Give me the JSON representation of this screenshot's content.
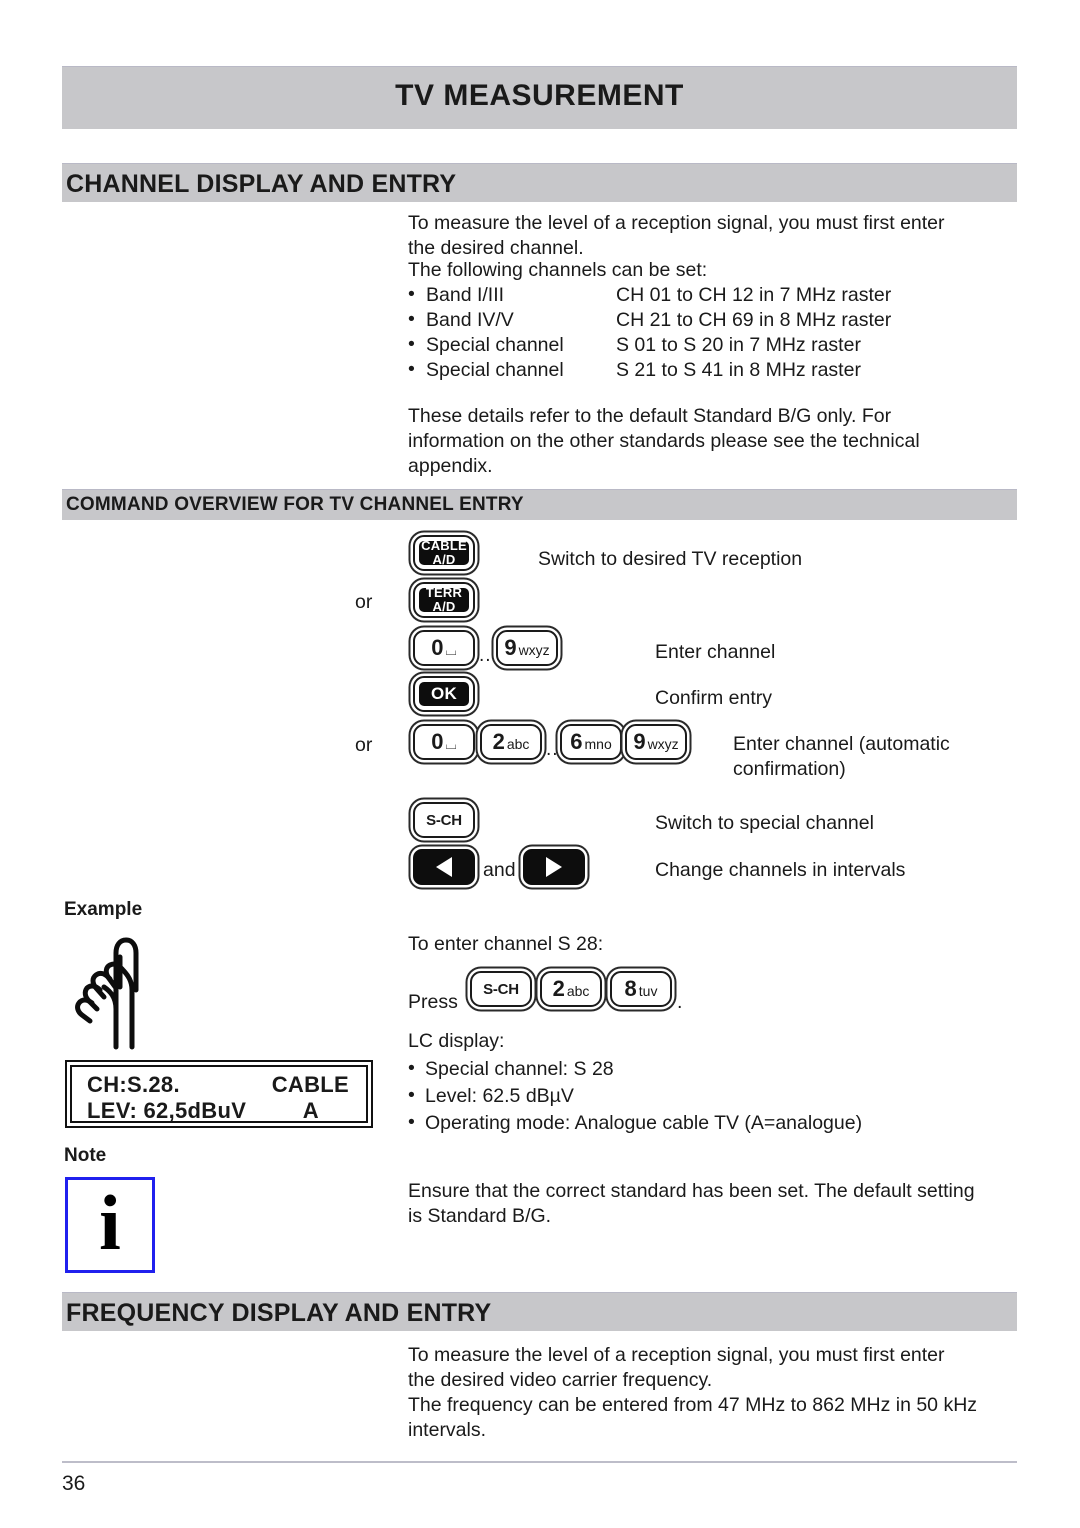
{
  "page": {
    "title": "TV MEASUREMENT",
    "number": "36"
  },
  "sections": {
    "channel": {
      "heading": "CHANNEL DISPLAY AND ENTRY",
      "intro_line1": "To measure the level of a reception signal, you must first enter",
      "intro_line2": "the desired channel.",
      "intro_line3": "The following channels can be set:",
      "channel_table": [
        {
          "bullet": "•",
          "band": "Band I/III",
          "range": "CH 01 to CH 12 in 7 MHz raster"
        },
        {
          "bullet": "•",
          "band": "Band IV/V",
          "range": "CH 21 to CH 69 in 8 MHz raster"
        },
        {
          "bullet": "•",
          "band": "Special channel",
          "range": "S 01 to S 20 in 7 MHz raster"
        },
        {
          "bullet": "•",
          "band": "Special channel",
          "range": "S 21 to S 41 in 8 MHz raster"
        }
      ],
      "note_line1": "These details refer to the default Standard B/G only. For",
      "note_line2": "information on the other standards please see the technical",
      "note_line3": "appendix."
    },
    "command_overview": {
      "heading": "COMMAND OVERVIEW FOR TV CHANNEL ENTRY",
      "or_label_1": "or",
      "or_label_2": "or",
      "and_label": "and",
      "ellipsis_1": "...",
      "ellipsis_2": "...",
      "keys": {
        "cable": {
          "line1": "CABLE",
          "line2": "A/D"
        },
        "terr": {
          "line1": "TERR",
          "line2": "A/D"
        },
        "zero": {
          "num": "0",
          "sub": "⌴"
        },
        "nine": {
          "num": "9",
          "sub": "wxyz"
        },
        "ok": {
          "label": "OK"
        },
        "two": {
          "num": "2",
          "sub": "abc"
        },
        "six": {
          "num": "6",
          "sub": "mno"
        },
        "nine2": {
          "num": "9",
          "sub": "wxyz"
        },
        "sch": {
          "label": "S-CH"
        },
        "left": {
          "label": "◀"
        },
        "right": {
          "label": "▶"
        }
      },
      "descriptions": {
        "switch_reception": "Switch to desired TV reception",
        "enter_channel": "Enter channel",
        "confirm_entry": "Confirm entry",
        "enter_channel_auto_l1": "Enter channel (automatic",
        "enter_channel_auto_l2": "confirmation)",
        "switch_special": "Switch to special channel",
        "change_intervals": "Change channels in intervals"
      }
    },
    "example": {
      "label": "Example",
      "intro": "To enter channel S 28:",
      "press_label": "Press",
      "press_suffix": ".",
      "press_keys": [
        {
          "type": "text",
          "label": "S-CH"
        },
        {
          "type": "num",
          "num": "2",
          "sub": "abc"
        },
        {
          "type": "num",
          "num": "8",
          "sub": "tuv"
        }
      ],
      "lcd": {
        "line1_left": "CH:S.28.",
        "line1_right": "CABLE",
        "line2_left": "LEV: 62,5dBuV",
        "line2_right": "A"
      },
      "display_title": "LC display:",
      "display_items": [
        {
          "bullet": "•",
          "text": "Special channel: S 28"
        },
        {
          "bullet": "•",
          "text": "Level: 62.5 dBµV"
        },
        {
          "bullet": "•",
          "text": "Operating mode: Analogue cable TV (A=analogue)"
        }
      ]
    },
    "note": {
      "label": "Note",
      "icon_glyph": "i",
      "text_line1": "Ensure that the correct standard has been set. The default setting",
      "text_line2": "is Standard B/G."
    },
    "frequency": {
      "heading": "FREQUENCY DISPLAY AND ENTRY",
      "line1": "To measure the level of a reception signal, you must first enter",
      "line2": "the desired video carrier frequency.",
      "line3": "The frequency can be entered from 47 MHz to 862 MHz in 50 kHz",
      "line4": "intervals."
    }
  },
  "colors": {
    "bar_gray": "#c7c7ca",
    "note_border_blue": "#2020ee",
    "key_black": "#0d0d0d",
    "text": "#1a1a1a"
  }
}
